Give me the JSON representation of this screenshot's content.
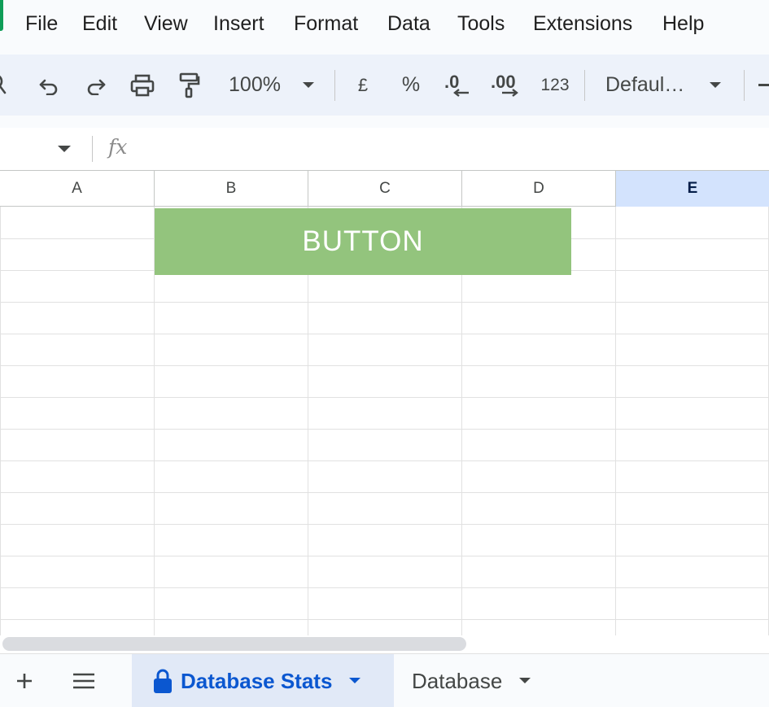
{
  "menu": {
    "items": [
      "File",
      "Edit",
      "View",
      "Insert",
      "Format",
      "Data",
      "Tools",
      "Extensions",
      "Help"
    ]
  },
  "toolbar": {
    "zoom": "100%",
    "currency_symbol": "£",
    "percent_symbol": "%",
    "decrease_decimals": ".0",
    "increase_decimals": ".00",
    "number_format": "123",
    "font_family": "Defaul…",
    "icons": [
      "search-icon",
      "undo-icon",
      "redo-icon",
      "print-icon",
      "paint-format-icon"
    ]
  },
  "formula_bar": {
    "fx_label": "fx",
    "value": ""
  },
  "grid": {
    "columns": [
      "A",
      "B",
      "C",
      "D",
      "E"
    ],
    "selected_column": "E",
    "button_label": "BUTTON",
    "button_color": "#93c47d"
  },
  "sheets": {
    "tabs": [
      {
        "label": "Database Stats",
        "active": true,
        "locked": true
      },
      {
        "label": "Database",
        "active": false,
        "locked": false
      }
    ]
  },
  "colors": {
    "accent": "#0b57d0",
    "selected_header_bg": "#d3e3fd",
    "toolbar_bg": "#edf2fa"
  }
}
